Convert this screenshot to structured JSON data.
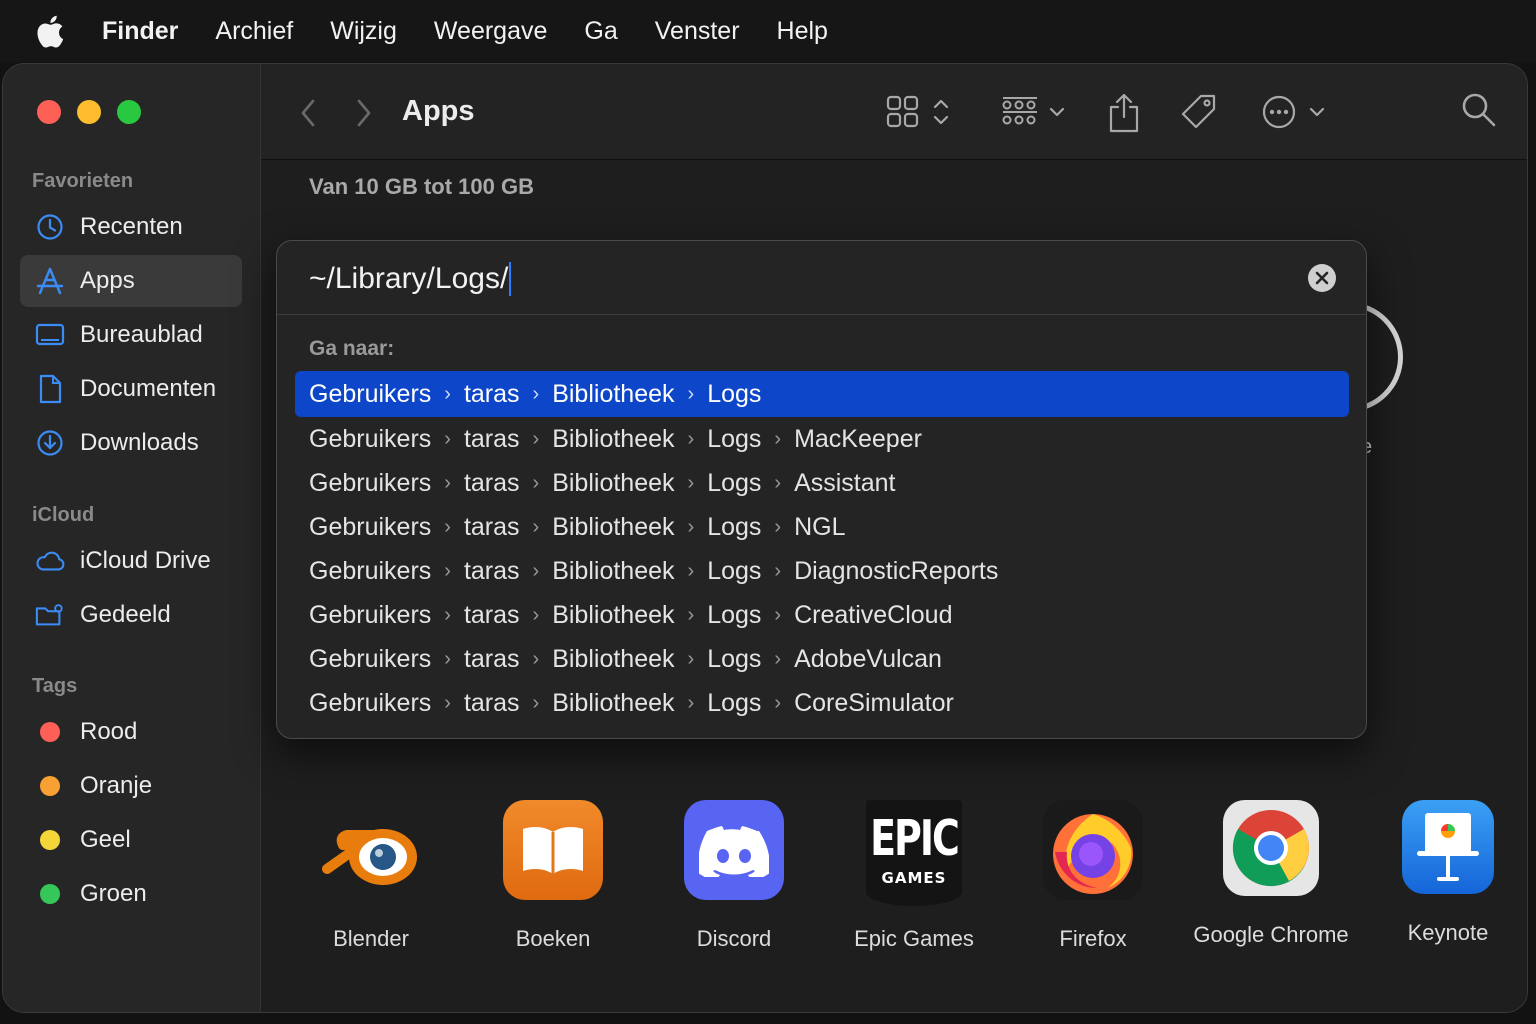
{
  "menubar": {
    "app_name": "Finder",
    "items": [
      "Archief",
      "Wijzig",
      "Weergave",
      "Ga",
      "Venster",
      "Help"
    ]
  },
  "sidebar": {
    "favorites_header": "Favorieten",
    "favorites": [
      {
        "label": "Recenten",
        "icon": "clock-icon"
      },
      {
        "label": "Apps",
        "icon": "apps-icon",
        "active": true
      },
      {
        "label": "Bureaublad",
        "icon": "desktop-icon"
      },
      {
        "label": "Documenten",
        "icon": "document-icon"
      },
      {
        "label": "Downloads",
        "icon": "download-icon"
      }
    ],
    "icloud_header": "iCloud",
    "icloud": [
      {
        "label": "iCloud Drive",
        "icon": "cloud-icon"
      },
      {
        "label": "Gedeeld",
        "icon": "shared-folder-icon"
      }
    ],
    "tags_header": "Tags",
    "tags": [
      {
        "label": "Rood",
        "color": "#fe5f57"
      },
      {
        "label": "Oranje",
        "color": "#f7a033"
      },
      {
        "label": "Geel",
        "color": "#f5d63a"
      },
      {
        "label": "Groen",
        "color": "#35c759"
      }
    ]
  },
  "toolbar": {
    "title": "Apps"
  },
  "content": {
    "group_label": "Van 10 GB tot 100 GB",
    "partial_label": "e",
    "apps": [
      {
        "label": "Blender"
      },
      {
        "label": "Boeken"
      },
      {
        "label": "Discord"
      },
      {
        "label": "Epic Games",
        "logo_top": "EPIC",
        "logo_bottom": "GAMES"
      },
      {
        "label": "Firefox"
      },
      {
        "label": "Google Chrome"
      },
      {
        "label": "Keynote"
      }
    ]
  },
  "dialog": {
    "path_value": "~/Library/Logs/",
    "goto_label": "Ga naar:",
    "results": [
      [
        "Gebruikers",
        "taras",
        "Bibliotheek",
        "Logs"
      ],
      [
        "Gebruikers",
        "taras",
        "Bibliotheek",
        "Logs",
        "MacKeeper"
      ],
      [
        "Gebruikers",
        "taras",
        "Bibliotheek",
        "Logs",
        "Assistant"
      ],
      [
        "Gebruikers",
        "taras",
        "Bibliotheek",
        "Logs",
        "NGL"
      ],
      [
        "Gebruikers",
        "taras",
        "Bibliotheek",
        "Logs",
        "DiagnosticReports"
      ],
      [
        "Gebruikers",
        "taras",
        "Bibliotheek",
        "Logs",
        "CreativeCloud"
      ],
      [
        "Gebruikers",
        "taras",
        "Bibliotheek",
        "Logs",
        "AdobeVulcan"
      ],
      [
        "Gebruikers",
        "taras",
        "Bibliotheek",
        "Logs",
        "CoreSimulator"
      ]
    ]
  }
}
